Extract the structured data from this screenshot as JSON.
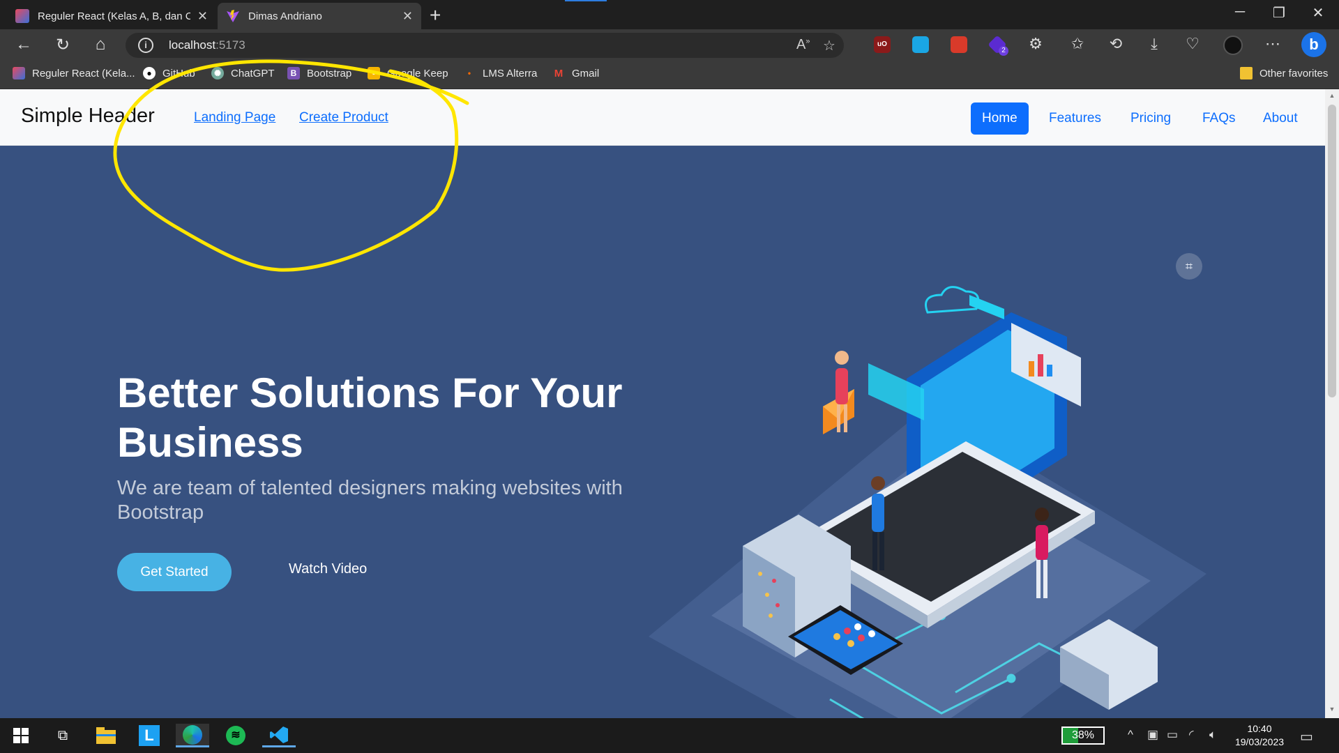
{
  "browser": {
    "tabs": [
      {
        "title": "Reguler React (Kelas A, B, dan C)",
        "active": false
      },
      {
        "title": "Dimas Andriano",
        "active": true
      }
    ],
    "address": {
      "host": "localhost",
      "port": ":5173"
    },
    "bookmarks": [
      {
        "label": "Reguler React (Kela...",
        "icon": "react-class-icon"
      },
      {
        "label": "GitHub",
        "icon": "github-icon"
      },
      {
        "label": "ChatGPT",
        "icon": "chatgpt-icon"
      },
      {
        "label": "Bootstrap",
        "icon": "bootstrap-icon"
      },
      {
        "label": "Google Keep",
        "icon": "google-keep-icon"
      },
      {
        "label": "LMS Alterra",
        "icon": "alterra-icon"
      },
      {
        "label": "Gmail",
        "icon": "gmail-icon"
      }
    ],
    "other_favorites": "Other favorites",
    "extension_badge": "2"
  },
  "site": {
    "brand": "Simple Header",
    "header_links": [
      "Landing Page",
      "Create Product"
    ],
    "nav": [
      "Home",
      "Features",
      "Pricing",
      "FAQs",
      "About"
    ],
    "active_nav": "Home",
    "hero": {
      "title": "Better Solutions For Your Business",
      "subtitle": "We are team of talented designers making websites with Bootstrap",
      "cta_primary": "Get Started",
      "cta_secondary": "Watch Video"
    }
  },
  "taskbar": {
    "battery": "38%",
    "battery_level": 0.38,
    "time": "10:40",
    "date": "19/03/2023"
  },
  "colors": {
    "hero_bg": "#375180",
    "primary": "#0d6efd",
    "cta": "#47b2e4",
    "annotation": "#ffe600"
  }
}
